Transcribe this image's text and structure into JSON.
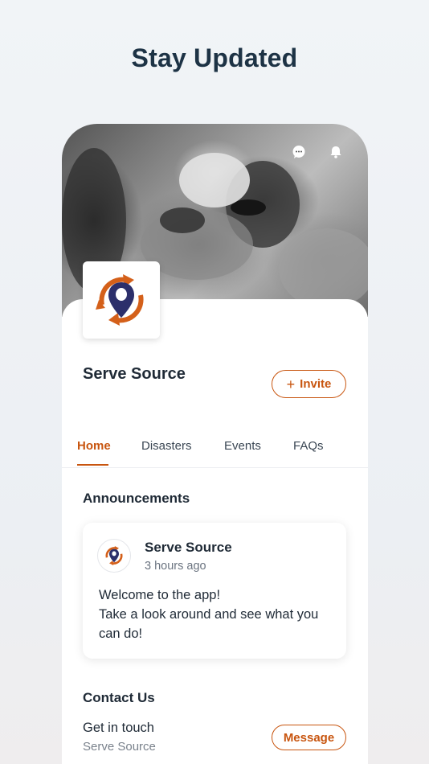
{
  "headline": "Stay Updated",
  "org": {
    "name": "Serve Source",
    "invite_label": "Invite",
    "invite_icon": "+"
  },
  "tabs": [
    {
      "label": "Home",
      "active": true
    },
    {
      "label": "Disasters",
      "active": false
    },
    {
      "label": "Events",
      "active": false
    },
    {
      "label": "FAQs",
      "active": false
    }
  ],
  "announcements": {
    "title": "Announcements",
    "post": {
      "author": "Serve Source",
      "time": "3 hours ago",
      "line1": "Welcome to the app!",
      "line2": "Take a look around and see what you can do!"
    }
  },
  "contact": {
    "title": "Contact Us",
    "line": "Get in touch",
    "sub": "Serve Source",
    "message_label": "Message"
  },
  "icons": {
    "chat": "chat-bubble-icon",
    "bell": "bell-icon",
    "logo": "serve-source-logo"
  },
  "colors": {
    "accent": "#c8550f",
    "logo_pin": "#2c2f6b",
    "logo_arrows": "#d4601a",
    "headline": "#1d3345"
  }
}
